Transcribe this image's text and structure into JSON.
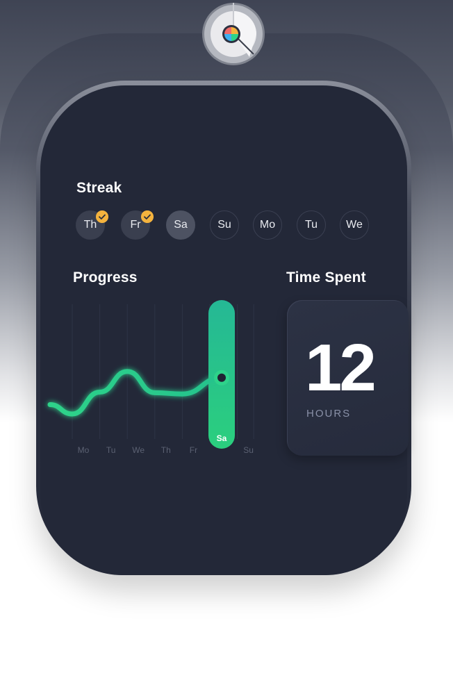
{
  "streak": {
    "title": "Streak",
    "days": [
      {
        "label": "Th",
        "done": true
      },
      {
        "label": "Fr",
        "done": true
      },
      {
        "label": "Sa",
        "done": false,
        "today": true
      },
      {
        "label": "Su",
        "done": false
      },
      {
        "label": "Mo",
        "done": false
      },
      {
        "label": "Tu",
        "done": false
      },
      {
        "label": "We",
        "done": false
      }
    ]
  },
  "progress": {
    "title": "Progress",
    "selected_day": "Sa"
  },
  "chart_data": {
    "type": "line",
    "title": "Progress",
    "categories": [
      "Mo",
      "Tu",
      "We",
      "Th",
      "Fr",
      "Sa",
      "Su"
    ],
    "series": [
      {
        "values": [
          0.1,
          0.45,
          0.78,
          0.44,
          0.42,
          0.68,
          null
        ]
      }
    ],
    "ylim": [
      0,
      1
    ],
    "highlight": "Sa",
    "grid": true,
    "colors": {
      "line": "#2ed38a",
      "highlight": "#22b892",
      "grid": "#2e3446"
    }
  },
  "time_spent": {
    "title": "Time Spent",
    "value": "12",
    "unit": "HOURS"
  },
  "colors": {
    "screen": "#232838",
    "accent_green": "#2ed38a",
    "check_badge": "#f4b33e",
    "text_primary": "#ffffff",
    "text_muted": "#8a91a8"
  }
}
